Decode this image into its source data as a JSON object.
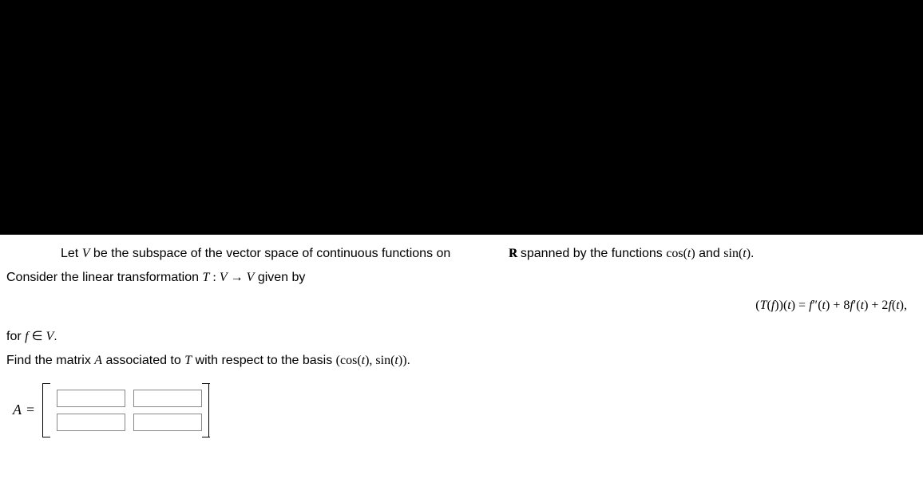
{
  "problem": {
    "line1_pre": "Let ",
    "line1_V": "V",
    "line1_mid": " be the subspace of the vector space of continuous functions on ",
    "line1_R": "R",
    "line1_post": " spanned by the functions ",
    "line1_cos": "cos(t)",
    "line1_and": " and ",
    "line1_sin": "sin(t)",
    "line1_end": ".",
    "line2_pre": "Consider the linear transformation ",
    "line2_T": "T",
    "line2_colon": " : ",
    "line2_V1": "V",
    "line2_arrow": " → ",
    "line2_V2": "V",
    "line2_post": " given by",
    "equation": "(T(f))(t) = f″(t) + 8f′(t) + 2f(t),",
    "line3_pre": "for ",
    "line3_f": "f",
    "line3_in": " ∈ ",
    "line3_V": "V",
    "line3_end": ".",
    "line4_pre": "Find the matrix ",
    "line4_A": "A",
    "line4_mid": " associated to ",
    "line4_T": "T",
    "line4_post": " with respect to the basis ",
    "line4_basis": "(cos(t), sin(t))",
    "line4_end": "."
  },
  "answer": {
    "A": "A",
    "eq": "=",
    "cells": {
      "a11": "",
      "a12": "",
      "a21": "",
      "a22": ""
    }
  }
}
